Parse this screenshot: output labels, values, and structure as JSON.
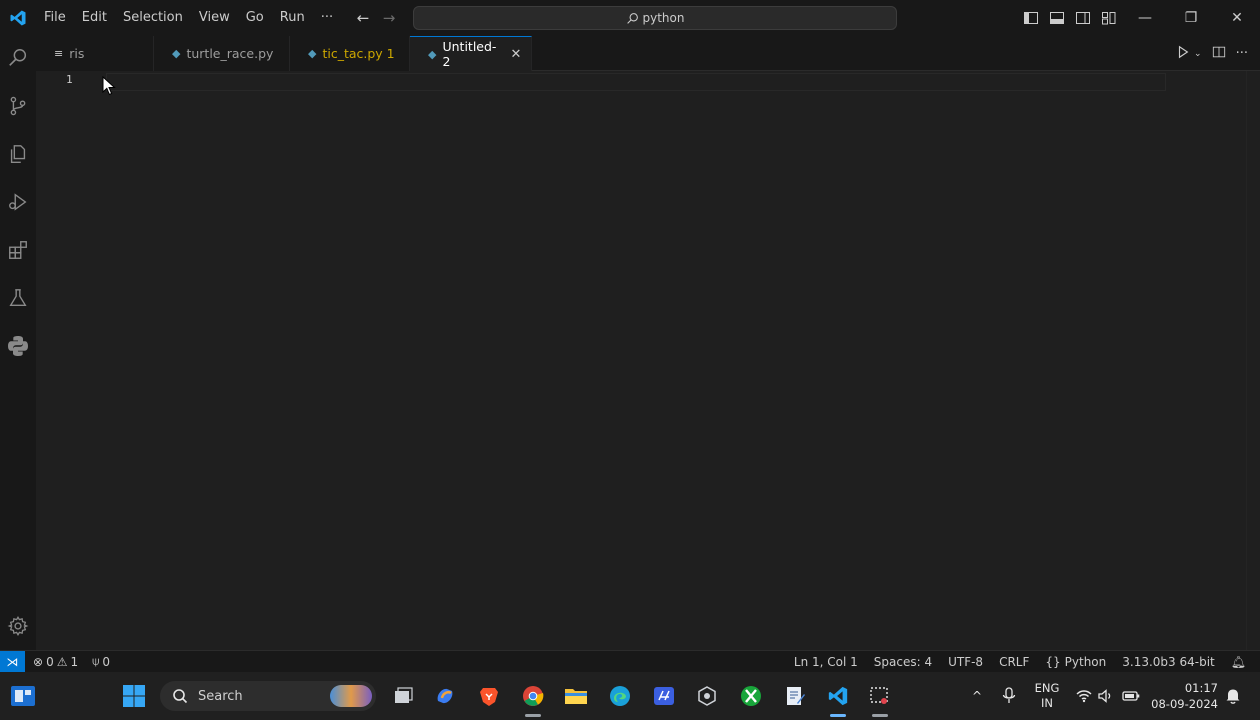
{
  "titlebar": {
    "menu": [
      "File",
      "Edit",
      "Selection",
      "View",
      "Go",
      "Run",
      "···"
    ],
    "search_text": "python"
  },
  "tabs": [
    {
      "label": "ris",
      "icon": "list-icon"
    },
    {
      "label": "turtle_race.py",
      "icon": "python-file-icon"
    },
    {
      "label": "tic_tac.py 1",
      "icon": "python-file-icon",
      "warning": true
    },
    {
      "label": "Untitled-2",
      "icon": "python-file-icon",
      "active": true
    }
  ],
  "editor": {
    "line_numbers": [
      "1"
    ]
  },
  "statusbar": {
    "errors": "0",
    "warnings": "1",
    "ports": "0",
    "position": "Ln 1, Col 1",
    "spaces": "Spaces: 4",
    "encoding": "UTF-8",
    "eol": "CRLF",
    "language": "Python",
    "interpreter": "3.13.0b3 64-bit"
  },
  "taskbar": {
    "search_label": "Search",
    "lang_line1": "ENG",
    "lang_line2": "IN",
    "time": "01:17",
    "date": "08-09-2024"
  },
  "colors": {
    "accent": "#0078d4",
    "warning": "#cca700",
    "python": "#519aba"
  }
}
